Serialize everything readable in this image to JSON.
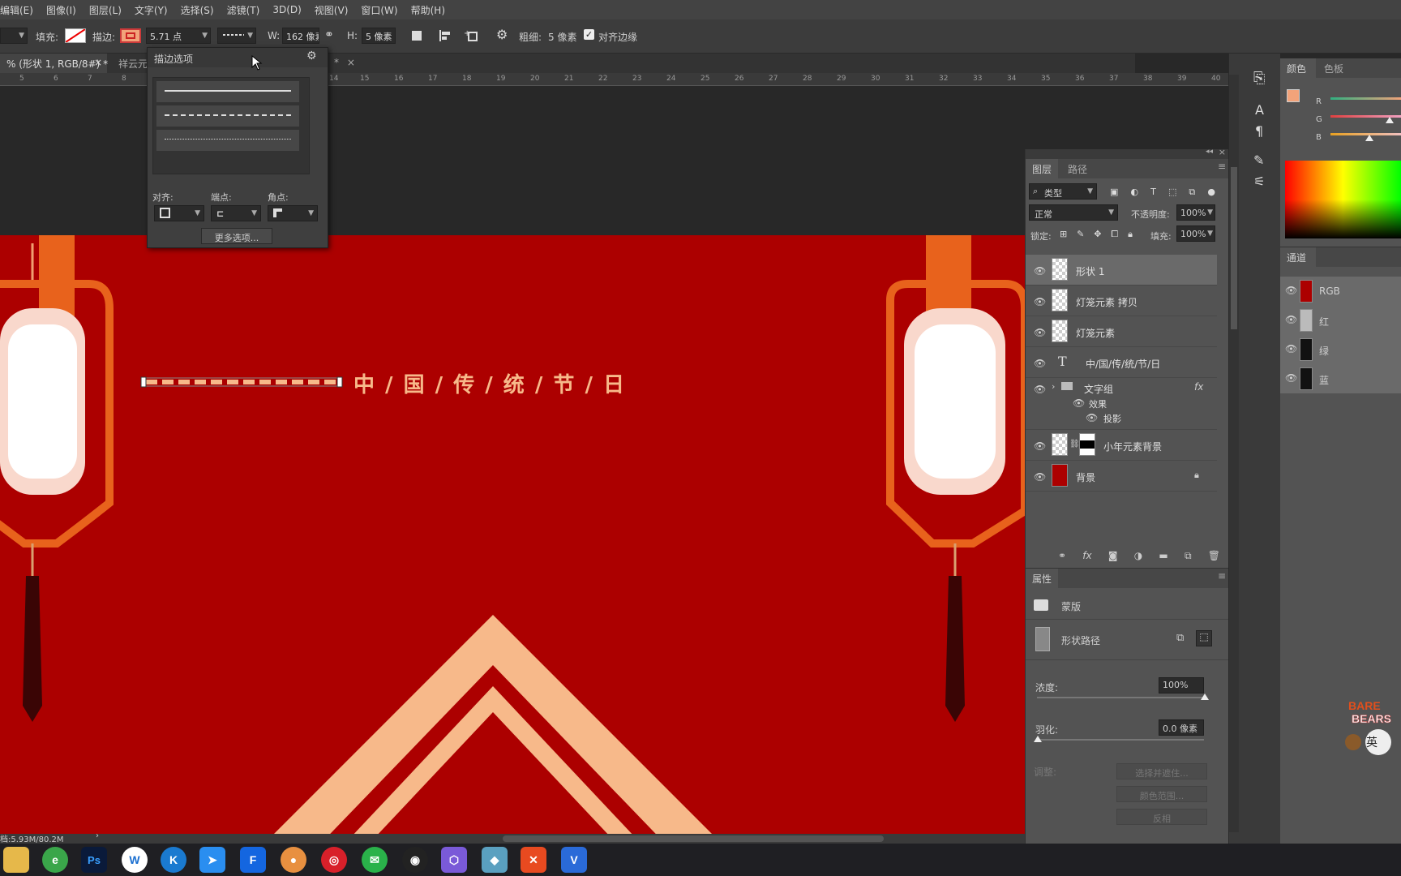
{
  "menubar": {
    "items": [
      "编辑(E)",
      "图像(I)",
      "图层(L)",
      "文字(Y)",
      "选择(S)",
      "滤镜(T)",
      "3D(D)",
      "视图(V)",
      "窗口(W)",
      "帮助(H)"
    ]
  },
  "options": {
    "fill_label": "填充:",
    "stroke_label": "描边:",
    "stroke_width": "5.71 点",
    "w_label": "W:",
    "w_value": "162 像素",
    "h_label": "H:",
    "h_value": "5 像素",
    "thickness_label": "粗细:",
    "thickness_value": "5 像素",
    "align_edges_label": "对齐边缘"
  },
  "tabs": {
    "doc1": "% (形状 1, RGB/8#) *",
    "doc2": "祥云元",
    "doc3": "*"
  },
  "ruler": {
    "ticks": [
      "5",
      "6",
      "7",
      "8",
      "14",
      "15",
      "16",
      "17",
      "18",
      "19",
      "20",
      "21",
      "22",
      "23",
      "24",
      "25",
      "26",
      "27",
      "28",
      "29",
      "30",
      "31",
      "32",
      "33",
      "34",
      "35",
      "36",
      "37",
      "38",
      "39",
      "40"
    ]
  },
  "stroke_popup": {
    "title": "描边选项",
    "align_label": "对齐:",
    "caps_label": "端点:",
    "corners_label": "角点:",
    "more_button": "更多选项..."
  },
  "canvas": {
    "title_text": "中 / 国 / 传 / 统 / 节 / 日"
  },
  "layers_panel": {
    "tab_layers": "图层",
    "tab_paths": "路径",
    "filter_kind": "类型",
    "blend_mode": "正常",
    "opacity_label": "不透明度:",
    "opacity_value": "100%",
    "lock_label": "锁定:",
    "fill_label": "填充:",
    "fill_value": "100%",
    "layers": [
      {
        "name": "形状 1"
      },
      {
        "name": "灯笼元素 拷贝"
      },
      {
        "name": "灯笼元素"
      },
      {
        "name": "中/国/传/统/节/日"
      },
      {
        "name": "文字组"
      },
      {
        "name": "效果"
      },
      {
        "name": "投影"
      },
      {
        "name": "小年元素背景"
      },
      {
        "name": "背景"
      }
    ]
  },
  "properties_panel": {
    "title": "属性",
    "mask_label": "蒙版",
    "path_label": "形状路径",
    "density_label": "浓度:",
    "density_value": "100%",
    "feather_label": "羽化:",
    "feather_value": "0.0 像素",
    "refine_label": "调整:",
    "select_and_mask": "选择并遮住...",
    "color_range": "颜色范围...",
    "invert": "反相"
  },
  "color_panel": {
    "tab_color": "颜色",
    "tab_swatches": "色板",
    "r": "R",
    "g": "G",
    "b": "B",
    "foreground_color": "#f2a37a"
  },
  "channels_panel": {
    "title": "通道",
    "channels": [
      {
        "name": "RGB"
      },
      {
        "name": "红"
      },
      {
        "name": "绿"
      },
      {
        "name": "蓝"
      }
    ]
  },
  "status": {
    "doc_size": "档:5.93M/80.2M"
  },
  "sticker": {
    "text": "英"
  },
  "colors": {
    "canvas_red": "#ac0000",
    "accent_peach": "#f7b98a",
    "lantern_orange": "#e8621c"
  },
  "taskbar": {
    "apps": [
      "file-explorer-icon",
      "green-app-icon",
      "photoshop-icon",
      "wps-icon",
      "k-app-icon",
      "bird-app-icon",
      "f-app-icon",
      "avatar-app-icon",
      "netease-music-icon",
      "wechat-icon",
      "qq-icon",
      "box-app-icon",
      "tool-app-icon",
      "x-app-icon",
      "v-app-icon"
    ]
  }
}
